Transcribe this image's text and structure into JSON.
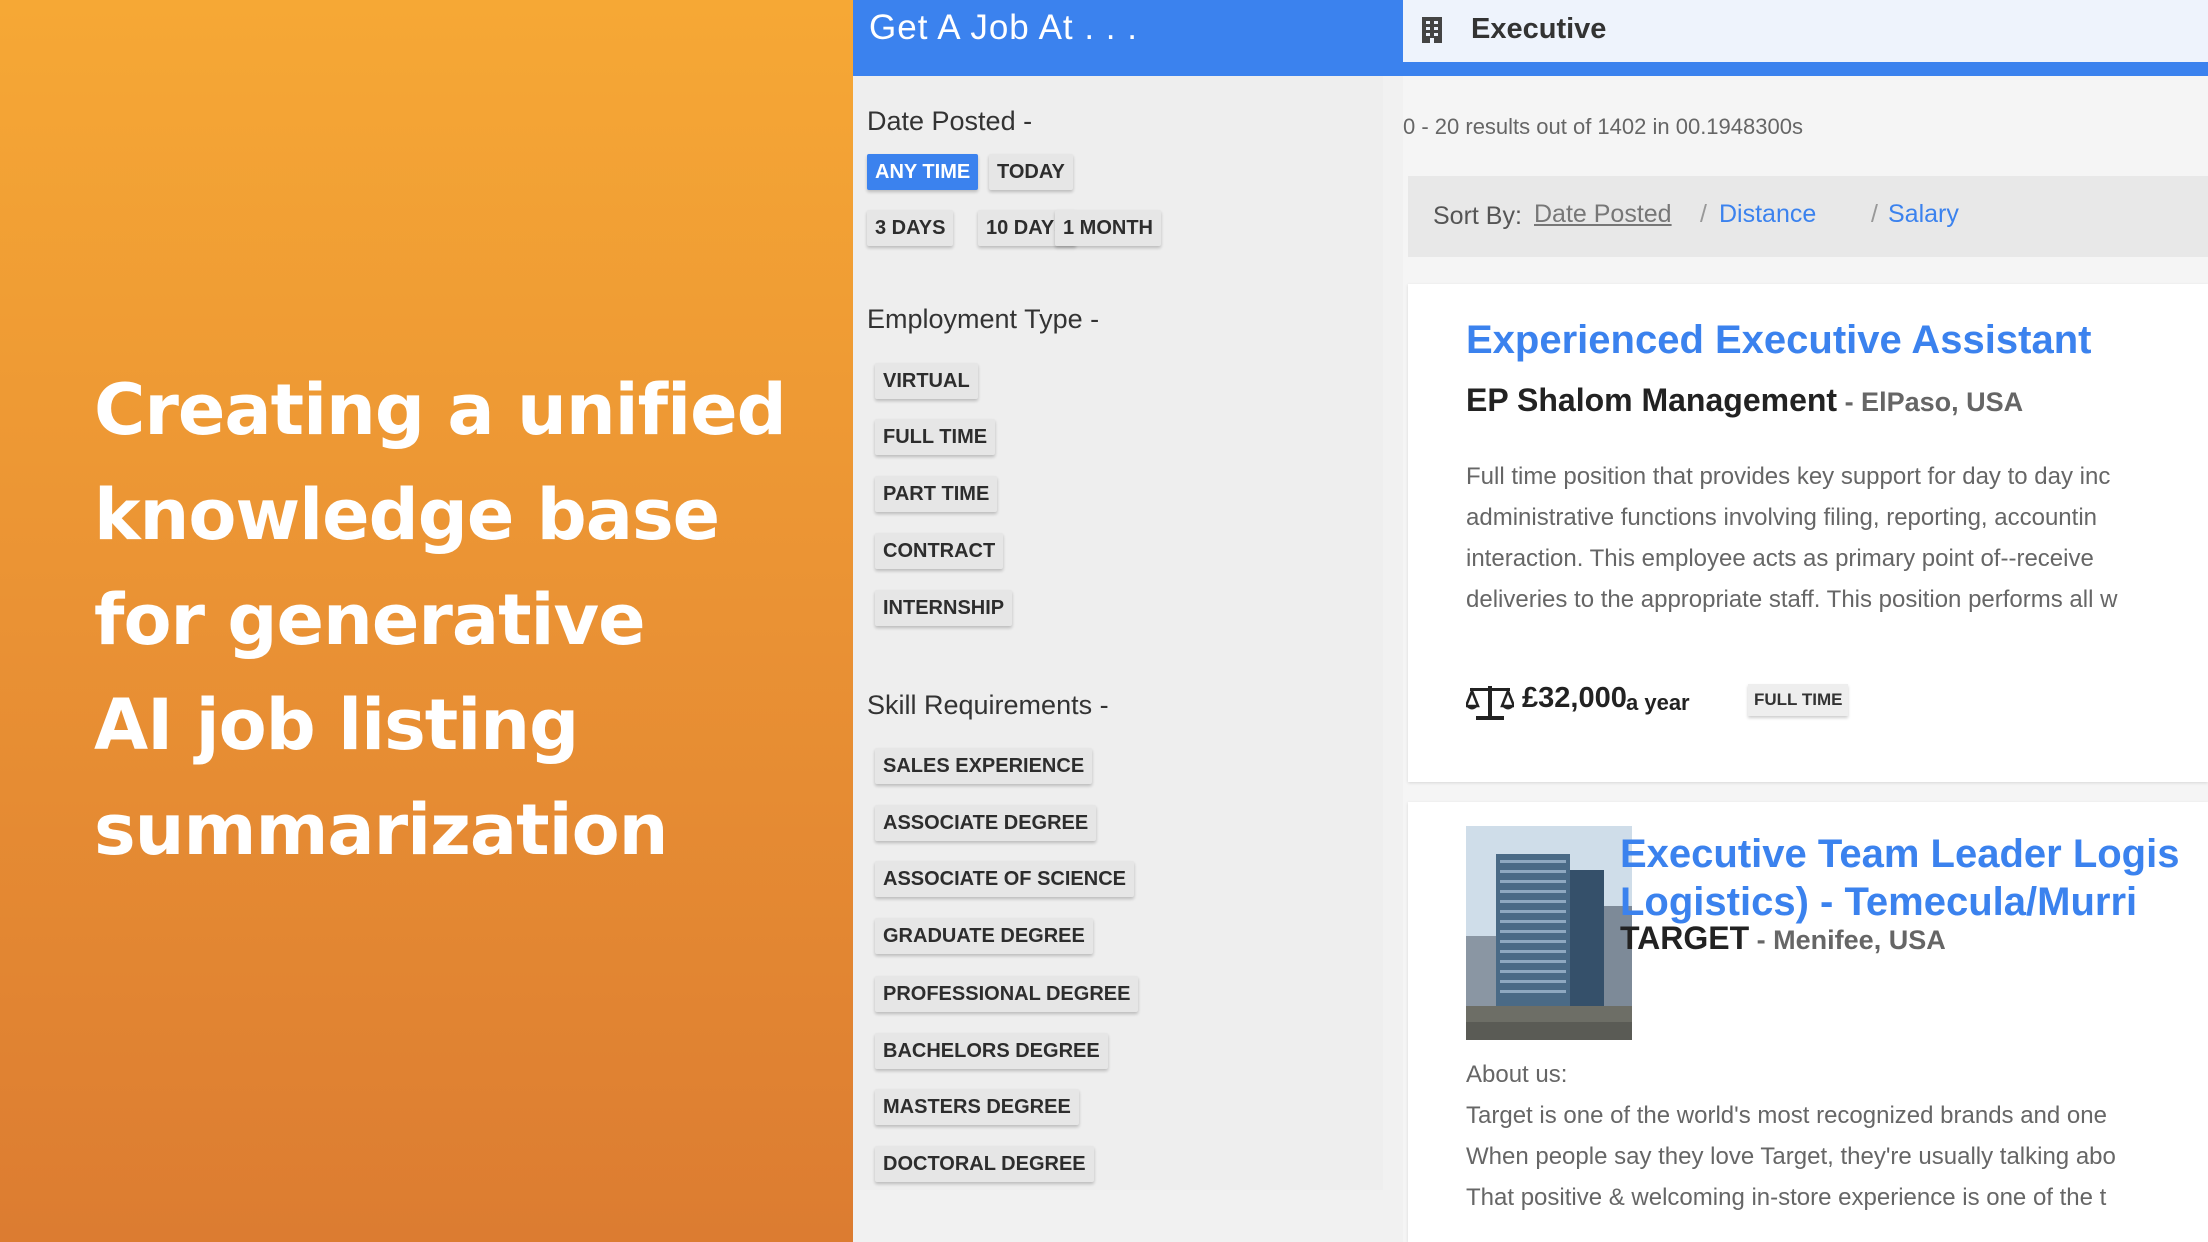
{
  "promo": {
    "lines": [
      "Creating a unified",
      "knowledge base",
      "for generative",
      "AI job listing",
      "summarization"
    ]
  },
  "app": {
    "title": "Get A Job At . . .",
    "search_value": "Executive",
    "accent": "#3b82ee"
  },
  "filters": {
    "date_posted": {
      "title": "Date Posted -",
      "options": [
        "ANY TIME",
        "TODAY",
        "3 DAYS",
        "10 DAYS",
        "1 MONTH"
      ],
      "selected": "ANY TIME"
    },
    "employment_type": {
      "title": "Employment Type -",
      "options": [
        "VIRTUAL",
        "FULL TIME",
        "PART TIME",
        "CONTRACT",
        "INTERNSHIP"
      ]
    },
    "skills": {
      "title": "Skill Requirements -",
      "options": [
        "SALES EXPERIENCE",
        "ASSOCIATE DEGREE",
        "ASSOCIATE OF SCIENCE",
        "GRADUATE DEGREE",
        "PROFESSIONAL DEGREE",
        "BACHELORS DEGREE",
        "MASTERS DEGREE",
        "DOCTORAL DEGREE"
      ]
    }
  },
  "results": {
    "count_text": "0 - 20 results out of 1402 in 00.1948300s",
    "sort": {
      "label": "Sort By:",
      "options": [
        "Date Posted",
        "Distance",
        "Salary"
      ],
      "current": "Date Posted",
      "separator": "/"
    },
    "jobs": [
      {
        "title": "Experienced Executive Assistant",
        "company": "EP Shalom Management",
        "location": " - ElPaso, USA",
        "description": [
          "Full time position that provides key support for day to day inc",
          "administrative functions involving filing, reporting, accountin",
          "interaction. This employee acts as primary point of--receive",
          "deliveries to the appropriate staff. This position performs all w"
        ],
        "salary": "£32,000",
        "salary_unit": "a year",
        "type": "FULL TIME"
      },
      {
        "title_lines": [
          "Executive Team Leader Logis",
          "Logistics) - Temecula/Murri"
        ],
        "company": "TARGET",
        "location": " - Menifee, USA",
        "description": [
          "About us:",
          "Target is one of the world's most recognized brands and one",
          "When people say they love Target, they're usually talking abo",
          "That positive & welcoming in-store experience is one of the t"
        ]
      }
    ]
  }
}
